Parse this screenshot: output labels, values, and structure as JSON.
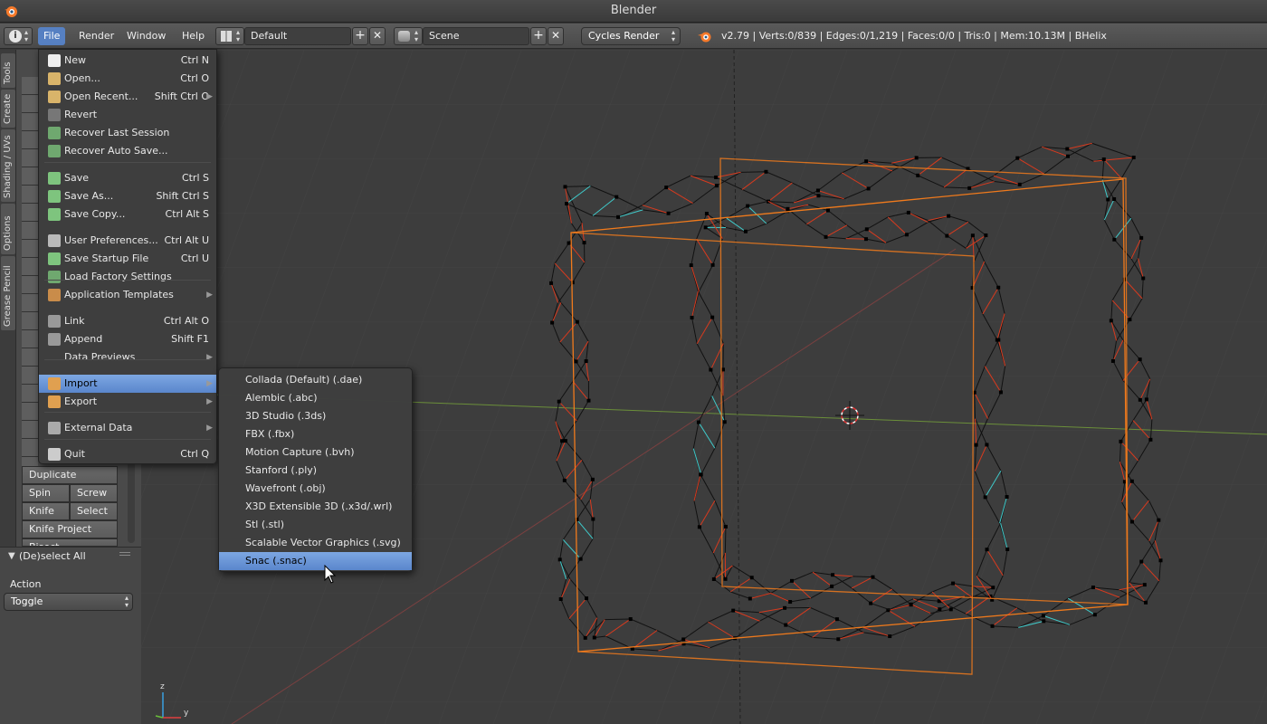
{
  "window": {
    "title": "Blender"
  },
  "header": {
    "menus": [
      "File",
      "Render",
      "Window",
      "Help"
    ],
    "layout_field": "Default",
    "scene_field": "Scene",
    "render_engine": "Cycles Render",
    "stats": "v2.79 | Verts:0/839 | Edges:0/1,219 | Faces:0/0 | Tris:0 | Mem:10.13M | BHelix"
  },
  "tool_tabs": [
    "Tools",
    "Create",
    "Shading / UVs",
    "Options",
    "Grease Pencil"
  ],
  "tools": {
    "duplicate": "Duplicate",
    "spin": "Spin",
    "screw": "Screw",
    "knife": "Knife",
    "select": "Select",
    "knife_project": "Knife Project",
    "bisect": "Bisect"
  },
  "redo_panel": {
    "title": "(De)select All",
    "action_label": "Action",
    "action_value": "Toggle"
  },
  "file_menu": [
    {
      "label": "New",
      "shortcut": "Ctrl N",
      "icon": "new-file-icon"
    },
    {
      "label": "Open...",
      "shortcut": "Ctrl O",
      "icon": "folder-icon"
    },
    {
      "label": "Open Recent...",
      "shortcut": "Shift Ctrl O",
      "icon": "folder-recent-icon"
    },
    {
      "label": "Revert",
      "shortcut": "",
      "icon": "revert-icon"
    },
    {
      "label": "Recover Last Session",
      "shortcut": "",
      "icon": "recover-icon"
    },
    {
      "label": "Recover Auto Save...",
      "shortcut": "",
      "icon": "recover-icon"
    },
    {
      "label": "Save",
      "shortcut": "Ctrl S",
      "icon": "check-icon"
    },
    {
      "label": "Save As...",
      "shortcut": "Shift Ctrl S",
      "icon": "check-icon"
    },
    {
      "label": "Save Copy...",
      "shortcut": "Ctrl Alt S",
      "icon": "check-icon"
    },
    {
      "label": "User Preferences...",
      "shortcut": "Ctrl Alt U",
      "icon": "preferences-icon"
    },
    {
      "label": "Save Startup File",
      "shortcut": "Ctrl U",
      "icon": "check-icon"
    },
    {
      "label": "Load Factory Settings",
      "shortcut": "",
      "icon": "recover-icon"
    },
    {
      "label": "Application Templates",
      "shortcut": "",
      "icon": "template-icon"
    },
    {
      "label": "Link",
      "shortcut": "Ctrl Alt O",
      "icon": "link-icon"
    },
    {
      "label": "Append",
      "shortcut": "Shift F1",
      "icon": "append-icon"
    },
    {
      "label": "Data Previews",
      "shortcut": "",
      "icon": ""
    },
    {
      "label": "Import",
      "shortcut": "",
      "icon": "import-icon"
    },
    {
      "label": "Export",
      "shortcut": "",
      "icon": "export-icon"
    },
    {
      "label": "External Data",
      "shortcut": "",
      "icon": "external-data-icon"
    },
    {
      "label": "Quit",
      "shortcut": "Ctrl Q",
      "icon": "power-icon"
    }
  ],
  "import_menu": [
    "Collada (Default) (.dae)",
    "Alembic (.abc)",
    "3D Studio (.3ds)",
    "FBX (.fbx)",
    "Motion Capture (.bvh)",
    "Stanford (.ply)",
    "Wavefront (.obj)",
    "X3D Extensible 3D (.x3d/.wrl)",
    "Stl (.stl)",
    "Scalable Vector Graphics (.svg)",
    "Snac (.snac)"
  ],
  "colors": {
    "highlight": "#5a86cc",
    "wire_red": "#d83a1e",
    "bbox_orange": "#f07a1c",
    "wire_cyan": "#3fc9c9"
  }
}
